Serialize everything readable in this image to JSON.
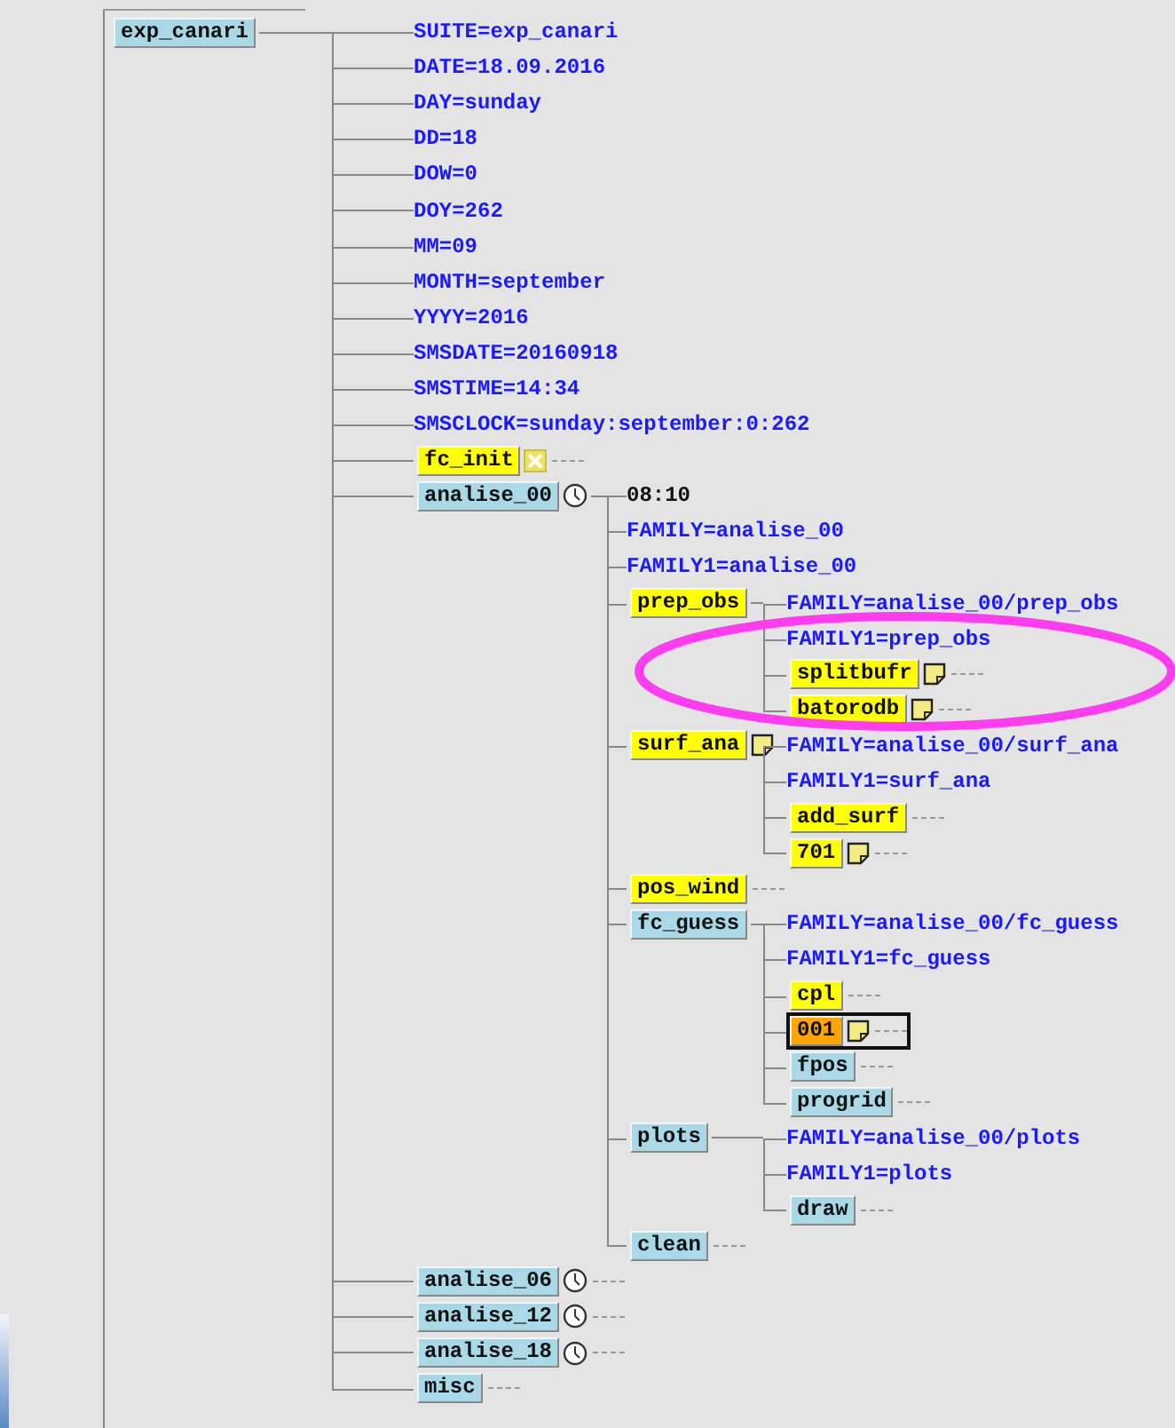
{
  "suite": {
    "label": "exp_canari",
    "kind": "node",
    "color": "#a9d9e6",
    "selected": false,
    "children": [
      {
        "label": "SUITE=exp_canari",
        "kind": "var"
      },
      {
        "label": "DATE=18.09.2016",
        "kind": "var"
      },
      {
        "label": "DAY=sunday",
        "kind": "var"
      },
      {
        "label": "DD=18",
        "kind": "var"
      },
      {
        "label": "DOW=0",
        "kind": "var"
      },
      {
        "label": "DOY=262",
        "kind": "var"
      },
      {
        "label": "MM=09",
        "kind": "var"
      },
      {
        "label": "MONTH=september",
        "kind": "var"
      },
      {
        "label": "YYYY=2016",
        "kind": "var"
      },
      {
        "label": "SMSDATE=20160918",
        "kind": "var"
      },
      {
        "label": "SMSTIME=14:34",
        "kind": "var"
      },
      {
        "label": "SMSCLOCK=sunday:september:0:262",
        "kind": "var"
      },
      {
        "label": "fc_init",
        "kind": "node",
        "color": "#ffff00",
        "selected": false,
        "icons": [
          {
            "kind": "cross"
          }
        ]
      },
      {
        "label": "analise_00",
        "kind": "node",
        "color": "#a9d9e6",
        "selected": false,
        "icons": [
          {
            "kind": "clock"
          }
        ],
        "children": [
          {
            "label": "08:10",
            "kind": "time"
          },
          {
            "label": "FAMILY=analise_00",
            "kind": "var"
          },
          {
            "label": "FAMILY1=analise_00",
            "kind": "var"
          },
          {
            "label": "prep_obs",
            "kind": "node",
            "color": "#ffff00",
            "selected": false,
            "children": [
              {
                "label": "FAMILY=analise_00/prep_obs",
                "kind": "var"
              },
              {
                "label": "FAMILY1=prep_obs",
                "kind": "var"
              },
              {
                "label": "splitbufr",
                "kind": "node",
                "color": "#ffff00",
                "selected": false,
                "icons": [
                  {
                    "kind": "note"
                  }
                ]
              },
              {
                "label": "batorodb",
                "kind": "node",
                "color": "#ffff00",
                "selected": false,
                "icons": [
                  {
                    "kind": "note"
                  }
                ]
              }
            ]
          },
          {
            "label": "surf_ana",
            "kind": "node",
            "color": "#ffff00",
            "selected": false,
            "icons": [
              {
                "kind": "note"
              }
            ],
            "children": [
              {
                "label": "FAMILY=analise_00/surf_ana",
                "kind": "var"
              },
              {
                "label": "FAMILY1=surf_ana",
                "kind": "var"
              },
              {
                "label": "add_surf",
                "kind": "node",
                "color": "#ffff00",
                "selected": false
              },
              {
                "label": "701",
                "kind": "node",
                "color": "#ffff00",
                "selected": false,
                "icons": [
                  {
                    "kind": "note"
                  }
                ]
              }
            ]
          },
          {
            "label": "pos_wind",
            "kind": "node",
            "color": "#ffff00",
            "selected": false
          },
          {
            "label": "fc_guess",
            "kind": "node",
            "color": "#a9d9e6",
            "selected": false,
            "children": [
              {
                "label": "FAMILY=analise_00/fc_guess",
                "kind": "var"
              },
              {
                "label": "FAMILY1=fc_guess",
                "kind": "var"
              },
              {
                "label": "cpl",
                "kind": "node",
                "color": "#ffff00",
                "selected": false
              },
              {
                "label": "001",
                "kind": "node",
                "color": "#ffa500",
                "selected": true,
                "icons": [
                  {
                    "kind": "note"
                  }
                ]
              },
              {
                "label": "fpos",
                "kind": "node",
                "color": "#a9d9e6",
                "selected": false
              },
              {
                "label": "progrid",
                "kind": "node",
                "color": "#a9d9e6",
                "selected": false
              }
            ]
          },
          {
            "label": "plots",
            "kind": "node",
            "color": "#a9d9e6",
            "selected": false,
            "children": [
              {
                "label": "FAMILY=analise_00/plots",
                "kind": "var"
              },
              {
                "label": "FAMILY1=plots",
                "kind": "var"
              },
              {
                "label": "draw",
                "kind": "node",
                "color": "#a9d9e6",
                "selected": false
              }
            ]
          },
          {
            "label": "clean",
            "kind": "node",
            "color": "#a9d9e6",
            "selected": false
          }
        ]
      },
      {
        "label": "analise_06",
        "kind": "node",
        "color": "#a9d9e6",
        "selected": false,
        "icons": [
          {
            "kind": "clock"
          }
        ]
      },
      {
        "label": "analise_12",
        "kind": "node",
        "color": "#a9d9e6",
        "selected": false,
        "icons": [
          {
            "kind": "clock"
          }
        ]
      },
      {
        "label": "analise_18",
        "kind": "node",
        "color": "#a9d9e6",
        "selected": false,
        "icons": [
          {
            "kind": "clock"
          }
        ]
      },
      {
        "label": "misc",
        "kind": "node",
        "color": "#a9d9e6",
        "selected": false
      }
    ]
  }
}
